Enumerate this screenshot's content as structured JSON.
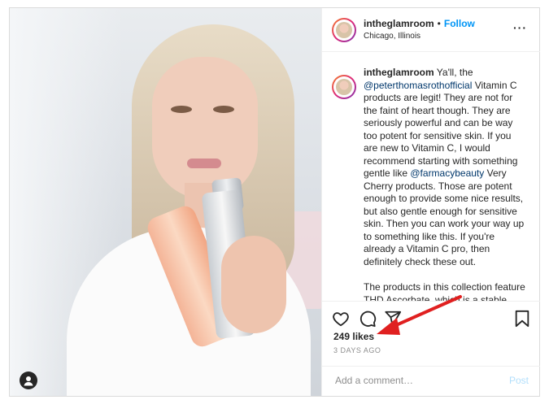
{
  "post": {
    "username": "intheglamroom",
    "separator": "•",
    "follow_label": "Follow",
    "location": "Chicago, Illinois",
    "more_label": "···",
    "caption": {
      "username": "intheglamroom",
      "p1_a": " Ya'll, the ",
      "mention1": "@peterthomasrothofficial",
      "p1_b": " Vitamin C products are legit! They are not for the faint of heart though. They are seriously powerful and can be way too potent for sensitive skin. If you are new to Vitamin C, I would recommend starting with something gentle like ",
      "mention2": "@farmacybeauty",
      "p1_c": " Very Cherry products. Those are potent enough to provide some nice results, but also gentle enough for sensitive skin. Then you can work your way up to something like this. If you're already a Vitamin C pro, then definitely check these out.",
      "p2": "The products in this collection feature THD Ascorbate, which is a stable, suuuuper potent version of"
    },
    "likes": "249 likes",
    "date": "3 DAYS AGO",
    "comment_placeholder": "Add a comment…",
    "post_label": "Post"
  },
  "icons": [
    "heart-icon",
    "comment-icon",
    "share-icon",
    "bookmark-icon",
    "user-tag-icon",
    "more-icon"
  ],
  "colors": {
    "accent": "#0095f6",
    "mention": "#00376b",
    "muted": "#8e8e8e",
    "post_disabled": "#b2dffc",
    "annotation_arrow": "#e02020"
  }
}
